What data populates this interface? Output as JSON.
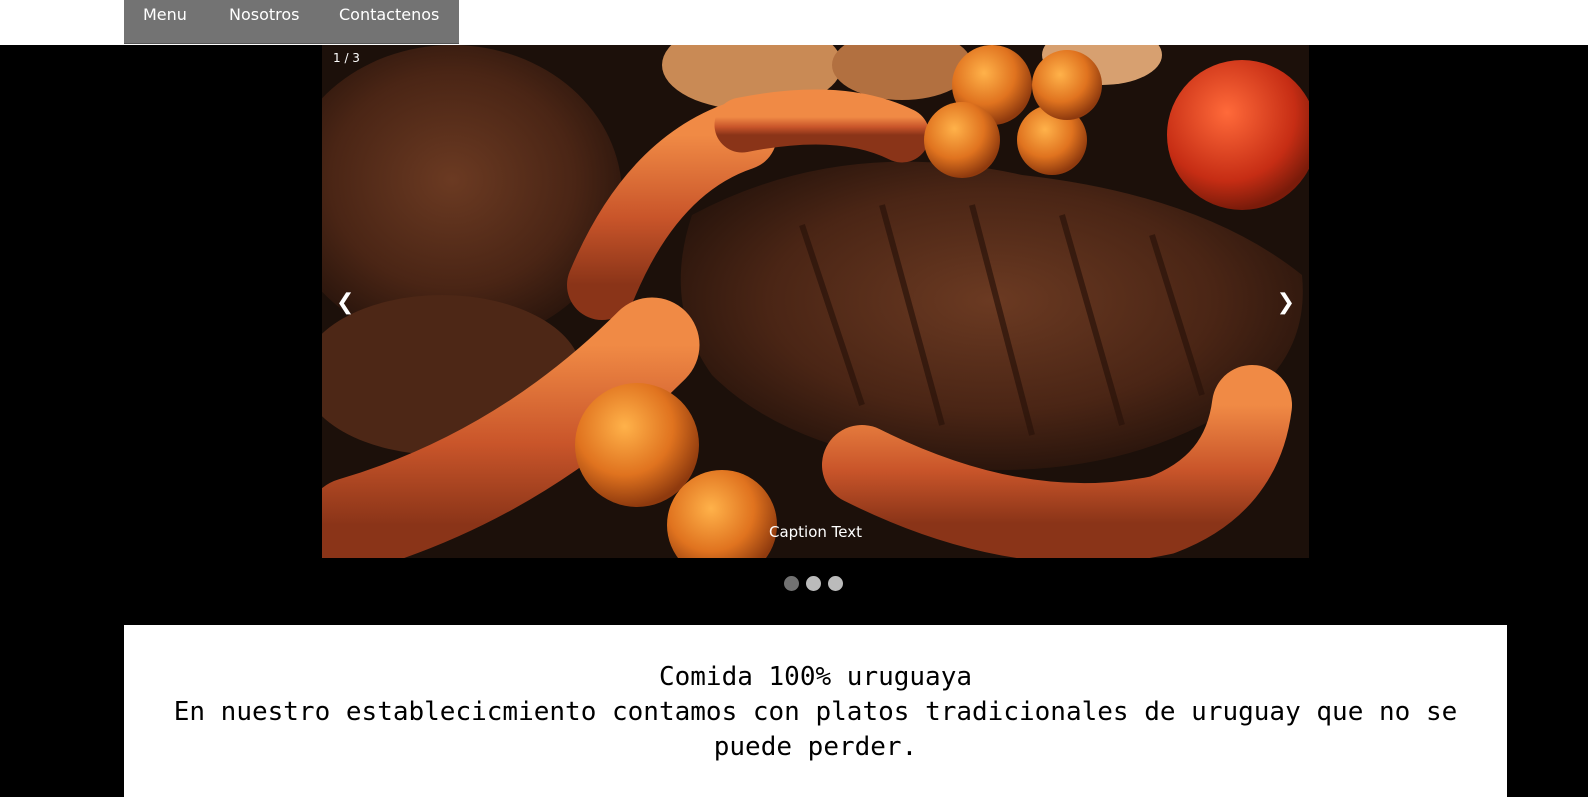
{
  "nav": {
    "items": [
      "Menu",
      "Nosotros",
      "Contactenos"
    ]
  },
  "slideshow": {
    "counter": "1 / 3",
    "caption": "Caption Text",
    "prev_label": "❮",
    "next_label": "❯",
    "dot_count": 3,
    "active_dot": 1
  },
  "content": {
    "title": "Comida 100% uruguaya",
    "description": "En nuestro establecicmiento contamos con platos tradicionales de uruguay que no se puede perder."
  },
  "colors": {
    "nav_bg": "#737373",
    "page_bg": "#000000",
    "dot_active": "#717171",
    "dot_inactive": "#bbbbbb"
  }
}
